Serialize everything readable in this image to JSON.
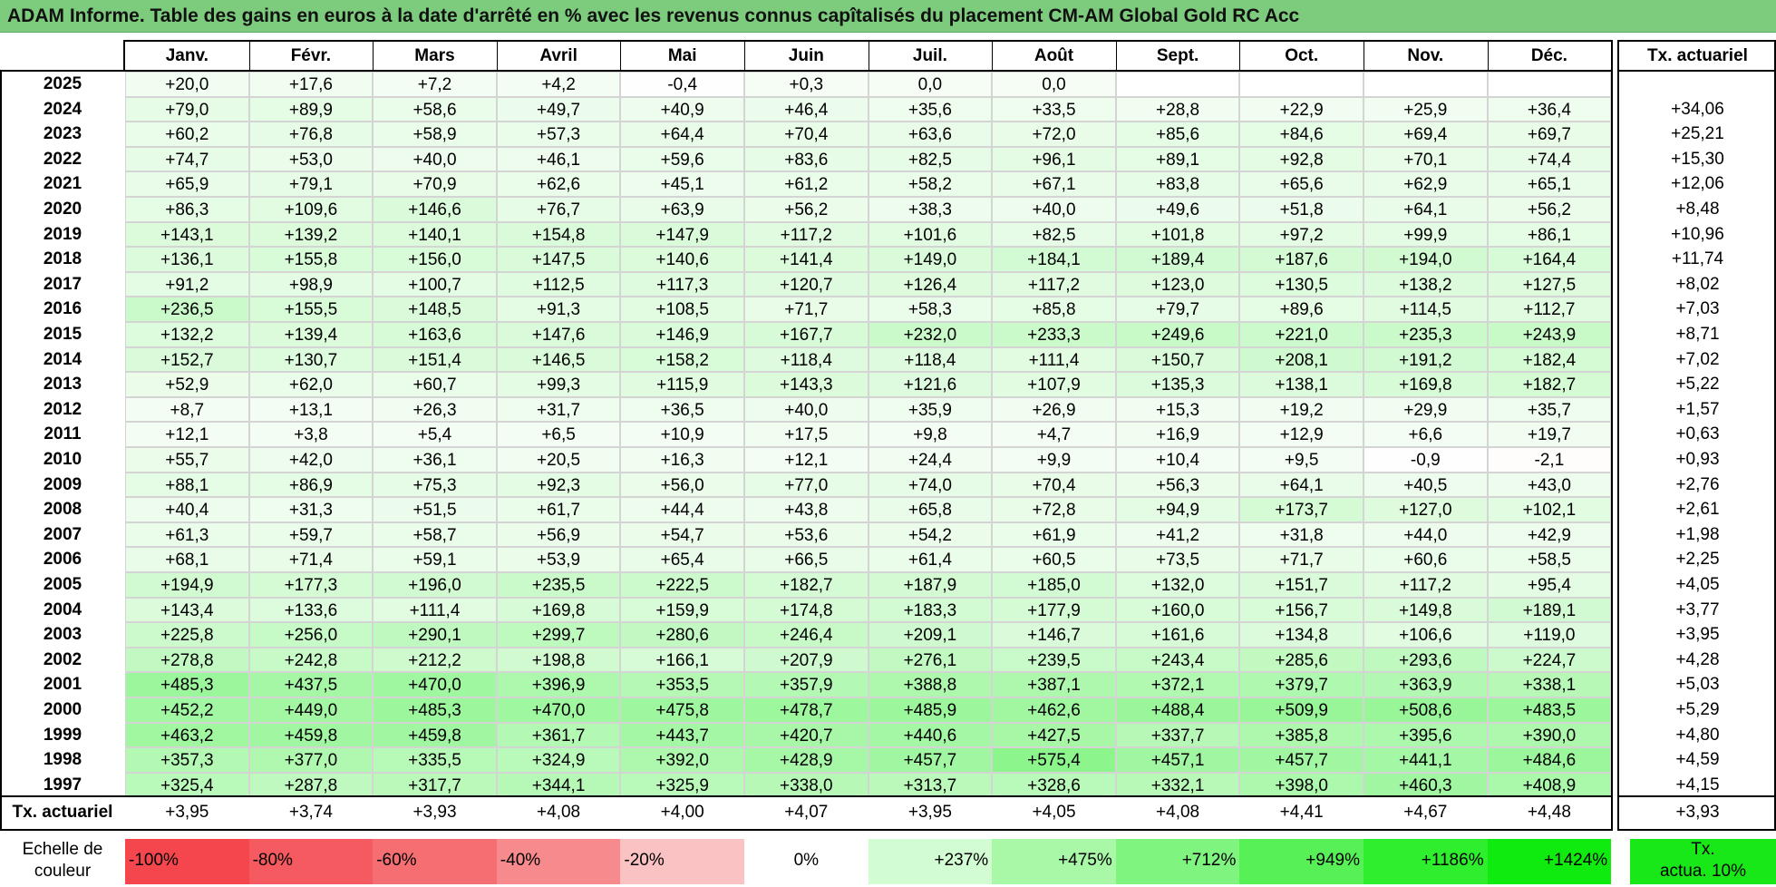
{
  "title": "ADAM Informe. Table des gains en euros à la date d'arrêté en % avec les revenus connus capîtalisés du placement CM-AM Global Gold RC Acc",
  "months": [
    "Janv.",
    "Févr.",
    "Mars",
    "Avril",
    "Mai",
    "Juin",
    "Juil.",
    "Août",
    "Sept.",
    "Oct.",
    "Nov.",
    "Déc."
  ],
  "rate_header": "Tx. actuariel",
  "rows": [
    {
      "year": "2025",
      "values": [
        "+20,0",
        "+17,6",
        "+7,2",
        "+4,2",
        "-0,4",
        "+0,3",
        "0,0",
        "0,0",
        "",
        "",
        "",
        ""
      ],
      "rate": ""
    },
    {
      "year": "2024",
      "values": [
        "+79,0",
        "+89,9",
        "+58,6",
        "+49,7",
        "+40,9",
        "+46,4",
        "+35,6",
        "+33,5",
        "+28,8",
        "+22,9",
        "+25,9",
        "+36,4"
      ],
      "rate": "+34,06"
    },
    {
      "year": "2023",
      "values": [
        "+60,2",
        "+76,8",
        "+58,9",
        "+57,3",
        "+64,4",
        "+70,4",
        "+63,6",
        "+72,0",
        "+85,6",
        "+84,6",
        "+69,4",
        "+69,7"
      ],
      "rate": "+25,21"
    },
    {
      "year": "2022",
      "values": [
        "+74,7",
        "+53,0",
        "+40,0",
        "+46,1",
        "+59,6",
        "+83,6",
        "+82,5",
        "+96,1",
        "+89,1",
        "+92,8",
        "+70,1",
        "+74,4"
      ],
      "rate": "+15,30"
    },
    {
      "year": "2021",
      "values": [
        "+65,9",
        "+79,1",
        "+70,9",
        "+62,6",
        "+45,1",
        "+61,2",
        "+58,2",
        "+67,1",
        "+83,8",
        "+65,6",
        "+62,9",
        "+65,1"
      ],
      "rate": "+12,06"
    },
    {
      "year": "2020",
      "values": [
        "+86,3",
        "+109,6",
        "+146,6",
        "+76,7",
        "+63,9",
        "+56,2",
        "+38,3",
        "+40,0",
        "+49,6",
        "+51,8",
        "+64,1",
        "+56,2"
      ],
      "rate": "+8,48"
    },
    {
      "year": "2019",
      "values": [
        "+143,1",
        "+139,2",
        "+140,1",
        "+154,8",
        "+147,9",
        "+117,2",
        "+101,6",
        "+82,5",
        "+101,8",
        "+97,2",
        "+99,9",
        "+86,1"
      ],
      "rate": "+10,96"
    },
    {
      "year": "2018",
      "values": [
        "+136,1",
        "+155,8",
        "+156,0",
        "+147,5",
        "+140,6",
        "+141,4",
        "+149,0",
        "+184,1",
        "+189,4",
        "+187,6",
        "+194,0",
        "+164,4"
      ],
      "rate": "+11,74"
    },
    {
      "year": "2017",
      "values": [
        "+91,2",
        "+98,9",
        "+100,7",
        "+112,5",
        "+117,3",
        "+120,7",
        "+126,4",
        "+117,2",
        "+123,0",
        "+130,5",
        "+138,2",
        "+127,5"
      ],
      "rate": "+8,02"
    },
    {
      "year": "2016",
      "values": [
        "+236,5",
        "+155,5",
        "+148,5",
        "+91,3",
        "+108,5",
        "+71,7",
        "+58,3",
        "+85,8",
        "+79,7",
        "+89,6",
        "+114,5",
        "+112,7"
      ],
      "rate": "+7,03"
    },
    {
      "year": "2015",
      "values": [
        "+132,2",
        "+139,4",
        "+163,6",
        "+147,6",
        "+146,9",
        "+167,7",
        "+232,0",
        "+233,3",
        "+249,6",
        "+221,0",
        "+235,3",
        "+243,9"
      ],
      "rate": "+8,71"
    },
    {
      "year": "2014",
      "values": [
        "+152,7",
        "+130,7",
        "+151,4",
        "+146,5",
        "+158,2",
        "+118,4",
        "+118,4",
        "+111,4",
        "+150,7",
        "+208,1",
        "+191,2",
        "+182,4"
      ],
      "rate": "+7,02"
    },
    {
      "year": "2013",
      "values": [
        "+52,9",
        "+62,0",
        "+60,7",
        "+99,3",
        "+115,9",
        "+143,3",
        "+121,6",
        "+107,9",
        "+135,3",
        "+138,1",
        "+169,8",
        "+182,7"
      ],
      "rate": "+5,22"
    },
    {
      "year": "2012",
      "values": [
        "+8,7",
        "+13,1",
        "+26,3",
        "+31,7",
        "+36,5",
        "+40,0",
        "+35,9",
        "+26,9",
        "+15,3",
        "+19,2",
        "+29,9",
        "+35,7"
      ],
      "rate": "+1,57"
    },
    {
      "year": "2011",
      "values": [
        "+12,1",
        "+3,8",
        "+5,4",
        "+6,5",
        "+10,9",
        "+17,5",
        "+9,8",
        "+4,7",
        "+16,9",
        "+12,9",
        "+6,6",
        "+19,7"
      ],
      "rate": "+0,63"
    },
    {
      "year": "2010",
      "values": [
        "+55,7",
        "+42,0",
        "+36,1",
        "+20,5",
        "+16,3",
        "+12,1",
        "+24,4",
        "+9,9",
        "+10,4",
        "+9,5",
        "-0,9",
        "-2,1"
      ],
      "rate": "+0,93"
    },
    {
      "year": "2009",
      "values": [
        "+88,1",
        "+86,9",
        "+75,3",
        "+92,3",
        "+56,0",
        "+77,0",
        "+74,0",
        "+70,4",
        "+56,3",
        "+64,1",
        "+40,5",
        "+43,0"
      ],
      "rate": "+2,76"
    },
    {
      "year": "2008",
      "values": [
        "+40,4",
        "+31,3",
        "+51,5",
        "+61,7",
        "+44,4",
        "+43,8",
        "+65,8",
        "+72,8",
        "+94,9",
        "+173,7",
        "+127,0",
        "+102,1"
      ],
      "rate": "+2,61"
    },
    {
      "year": "2007",
      "values": [
        "+61,3",
        "+59,7",
        "+58,7",
        "+56,9",
        "+54,7",
        "+53,6",
        "+54,2",
        "+61,9",
        "+41,2",
        "+31,8",
        "+44,0",
        "+42,9"
      ],
      "rate": "+1,98"
    },
    {
      "year": "2006",
      "values": [
        "+68,1",
        "+71,4",
        "+59,1",
        "+53,9",
        "+65,4",
        "+66,5",
        "+61,4",
        "+60,5",
        "+73,5",
        "+71,7",
        "+60,6",
        "+58,5"
      ],
      "rate": "+2,25"
    },
    {
      "year": "2005",
      "values": [
        "+194,9",
        "+177,3",
        "+196,0",
        "+235,5",
        "+222,5",
        "+182,7",
        "+187,9",
        "+185,0",
        "+132,0",
        "+151,7",
        "+117,2",
        "+95,4"
      ],
      "rate": "+4,05"
    },
    {
      "year": "2004",
      "values": [
        "+143,4",
        "+133,6",
        "+111,4",
        "+169,8",
        "+159,9",
        "+174,8",
        "+183,3",
        "+177,9",
        "+160,0",
        "+156,7",
        "+149,8",
        "+189,1"
      ],
      "rate": "+3,77"
    },
    {
      "year": "2003",
      "values": [
        "+225,8",
        "+256,0",
        "+290,1",
        "+299,7",
        "+280,6",
        "+246,4",
        "+209,1",
        "+146,7",
        "+161,6",
        "+134,8",
        "+106,6",
        "+119,0"
      ],
      "rate": "+3,95"
    },
    {
      "year": "2002",
      "values": [
        "+278,8",
        "+242,8",
        "+212,2",
        "+198,8",
        "+166,1",
        "+207,9",
        "+276,1",
        "+239,5",
        "+243,4",
        "+285,6",
        "+293,6",
        "+224,7"
      ],
      "rate": "+4,28"
    },
    {
      "year": "2001",
      "values": [
        "+485,3",
        "+437,5",
        "+470,0",
        "+396,9",
        "+353,5",
        "+357,9",
        "+388,8",
        "+387,1",
        "+372,1",
        "+379,7",
        "+363,9",
        "+338,1"
      ],
      "rate": "+5,03"
    },
    {
      "year": "2000",
      "values": [
        "+452,2",
        "+449,0",
        "+485,3",
        "+470,0",
        "+475,8",
        "+478,7",
        "+485,9",
        "+462,6",
        "+488,4",
        "+509,9",
        "+508,6",
        "+483,5"
      ],
      "rate": "+5,29"
    },
    {
      "year": "1999",
      "values": [
        "+463,2",
        "+459,8",
        "+459,8",
        "+361,7",
        "+443,7",
        "+420,7",
        "+440,6",
        "+427,5",
        "+337,7",
        "+385,8",
        "+395,6",
        "+390,0"
      ],
      "rate": "+4,80"
    },
    {
      "year": "1998",
      "values": [
        "+357,3",
        "+377,0",
        "+335,5",
        "+324,9",
        "+392,0",
        "+428,9",
        "+457,7",
        "+575,4",
        "+457,1",
        "+457,7",
        "+441,1",
        "+484,6"
      ],
      "rate": "+4,59"
    },
    {
      "year": "1997",
      "values": [
        "+325,4",
        "+287,8",
        "+317,7",
        "+344,1",
        "+325,9",
        "+338,0",
        "+313,7",
        "+328,6",
        "+332,1",
        "+398,0",
        "+460,3",
        "+408,9"
      ],
      "rate": "+4,15"
    }
  ],
  "footer": {
    "label": "Tx. actuariel",
    "values": [
      "+3,95",
      "+3,74",
      "+3,93",
      "+4,08",
      "+4,00",
      "+4,07",
      "+3,95",
      "+4,05",
      "+4,08",
      "+4,41",
      "+4,67",
      "+4,48"
    ],
    "rate": "+3,93"
  },
  "scale": {
    "label_line1": "Echelle de",
    "label_line2": "couleur",
    "items": [
      {
        "text": "-100%",
        "color": "#F4464C"
      },
      {
        "text": "-80%",
        "color": "#F45A5F"
      },
      {
        "text": "-60%",
        "color": "#F56E72"
      },
      {
        "text": "-40%",
        "color": "#F78A8D"
      },
      {
        "text": "-20%",
        "color": "#FBC2C3"
      },
      {
        "text": "0%",
        "color": "#FFFFFF"
      },
      {
        "text": "+237%",
        "color": "#D2FCD2"
      },
      {
        "text": "+475%",
        "color": "#A8F8A8"
      },
      {
        "text": "+712%",
        "color": "#7FF47F"
      },
      {
        "text": "+949%",
        "color": "#57F157"
      },
      {
        "text": "+1186%",
        "color": "#2EEE2E"
      },
      {
        "text": "+1424%",
        "color": "#0FEB0F"
      }
    ],
    "rate_box_line1": "Tx.",
    "rate_box_line2": "actua. 10%",
    "rate_box_color": "#18E818"
  }
}
